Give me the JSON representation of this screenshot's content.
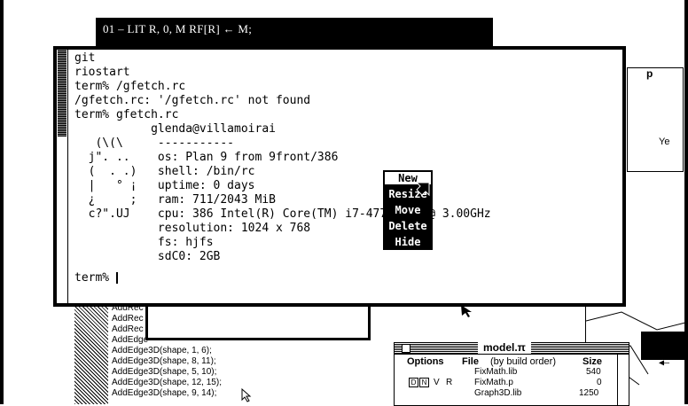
{
  "top_bar": {
    "text": "01 – LIT    R, 0,  M      RF[R] ← M;"
  },
  "code_window": {
    "lines": [
      "AddRec",
      "AddRec",
      "AddRec",
      "AddEdge",
      "AddEdge3D(shape, 1, 6);",
      "AddEdge3D(shape, 8, 11);",
      "AddEdge3D(shape, 5, 10);",
      "AddEdge3D(shape, 12, 15);",
      "AddEdge3D(shape, 9, 14);"
    ]
  },
  "model_window": {
    "title": "model.π",
    "headers": {
      "options": "Options",
      "file": "File",
      "file_note": "(by build order)",
      "size": "Size"
    },
    "rows": [
      {
        "file": "FixMath.lib",
        "size": "540"
      },
      {
        "file": "FixMath.p",
        "size": "0",
        "flags": [
          "D",
          "N",
          "V",
          "R"
        ]
      },
      {
        "file": "Graph3D.lib",
        "size": "1250"
      }
    ]
  },
  "right_strip": {
    "labels": [
      "p",
      "Ye"
    ]
  },
  "terminal": {
    "lines": [
      "git",
      "riostart",
      "term% /gfetch.rc",
      "/gfetch.rc: '/gfetch.rc' not found",
      "term% gfetch.rc",
      "           glenda@villamoirai",
      "   (\\(\\     -----------",
      "  j\". ..    os: Plan 9 from 9front/386",
      "  (  . .)   shell: /bin/rc",
      "  |   ° ¡   uptime: 0 days",
      "  ¿     ;   ram: 711/2043 MiB",
      "  c?\".UJ    cpu: 386 Intel(R) Core(TM) i7-4770 CPU @ 3.00GHz",
      "            resolution: 1024 x 768",
      "            fs: hjfs",
      "            sdC0: 2GB",
      "term% "
    ]
  },
  "rio_menu": {
    "items": [
      "New",
      "Resize",
      "Move",
      "Delete",
      "Hide"
    ],
    "selected": 0
  }
}
